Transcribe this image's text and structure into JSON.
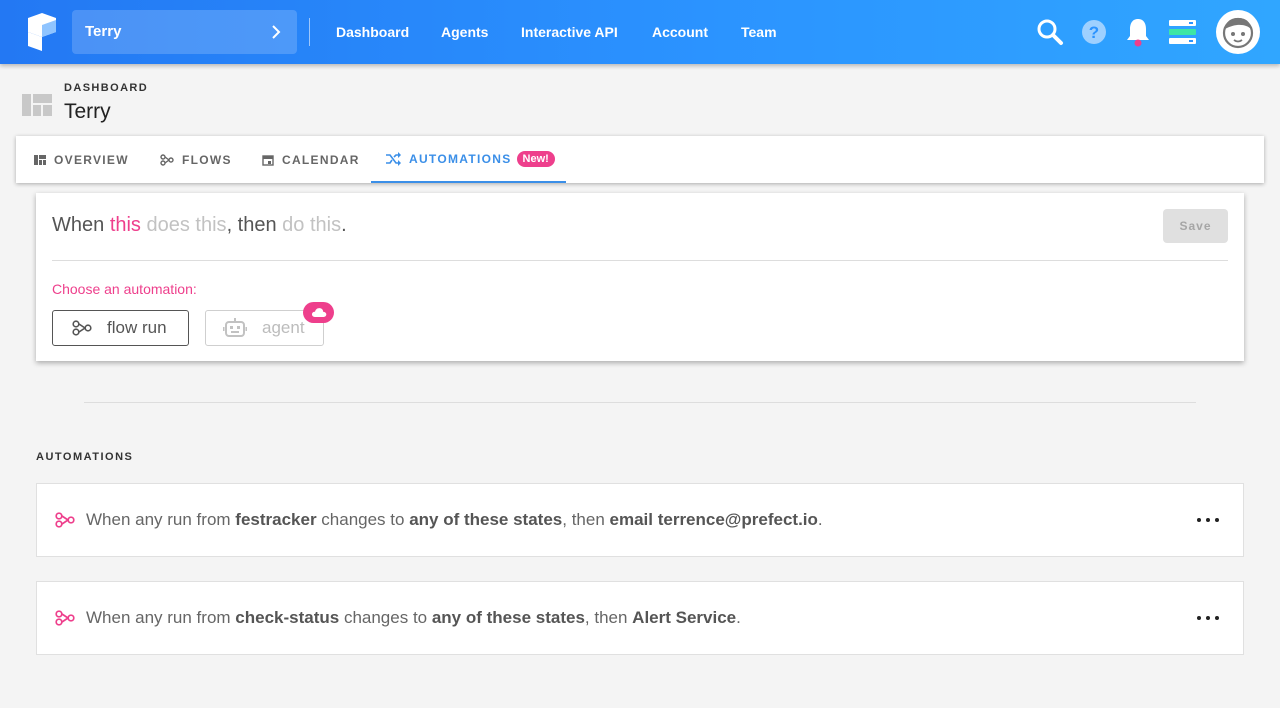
{
  "header": {
    "team_name": "Terry",
    "nav": [
      "Dashboard",
      "Agents",
      "Interactive API",
      "Account",
      "Team"
    ]
  },
  "page": {
    "breadcrumb": "DASHBOARD",
    "title": "Terry"
  },
  "tabs": [
    {
      "label": "OVERVIEW",
      "icon": "grid-icon"
    },
    {
      "label": "FLOWS",
      "icon": "flow-icon"
    },
    {
      "label": "CALENDAR",
      "icon": "calendar-icon"
    },
    {
      "label": "AUTOMATIONS",
      "icon": "shuffle-icon",
      "badge": "New!",
      "active": true
    }
  ],
  "builder": {
    "sentence": {
      "p1": "When ",
      "this": "this",
      "p2": " ",
      "does_this": "does this",
      "p3": ", then ",
      "do_this": "do this",
      "p4": "."
    },
    "save_label": "Save",
    "choose_label": "Choose an automation:",
    "options": [
      {
        "label": "flow run",
        "icon": "flow-icon"
      },
      {
        "label": "agent",
        "icon": "robot-icon",
        "badge_icon": "cloud-icon",
        "disabled": true
      }
    ]
  },
  "automations": {
    "title": "AUTOMATIONS",
    "items": [
      {
        "p1": "When any run from ",
        "b1": "festracker",
        "p2": " changes to ",
        "b2": "any of these states",
        "p3": ", then ",
        "b3": "email terrence@prefect.io",
        "p4": "."
      },
      {
        "p1": "When any run from ",
        "b1": "check-status",
        "p2": " changes to ",
        "b2": "any of these states",
        "p3": ", then ",
        "b3": "Alert Service",
        "p4": "."
      }
    ]
  },
  "colors": {
    "accent_blue": "#3b8fe8",
    "accent_pink": "#ee3f8c",
    "header_blue": "#2b93ff"
  }
}
